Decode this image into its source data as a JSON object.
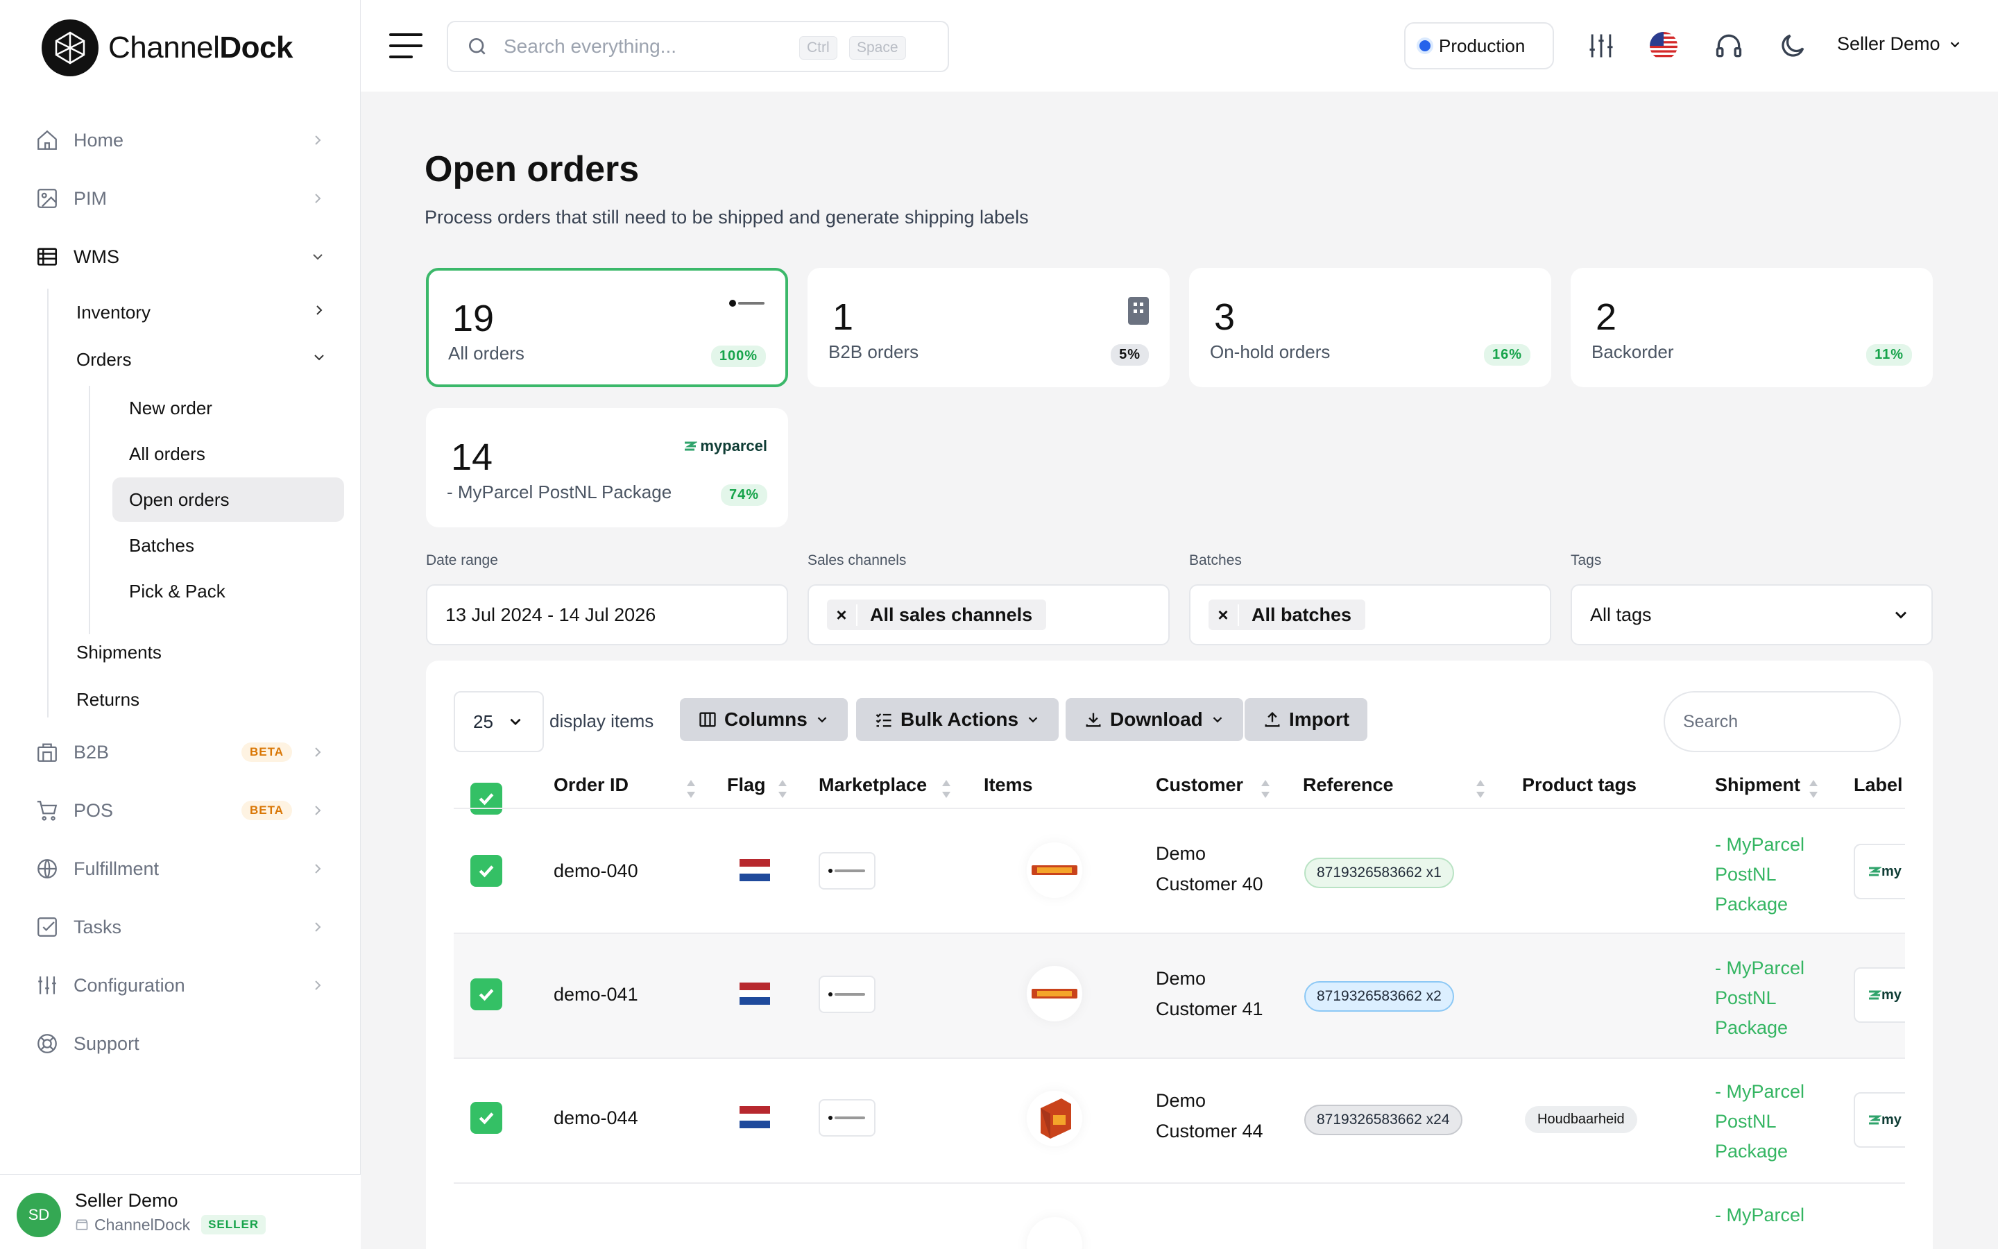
{
  "brand": {
    "name_light": "Channel",
    "name_bold": "Dock"
  },
  "sidebar": {
    "items": [
      {
        "label": "Home",
        "icon": "home-icon"
      },
      {
        "label": "PIM",
        "icon": "image-icon"
      },
      {
        "label": "WMS",
        "icon": "table-icon"
      },
      {
        "label": "B2B",
        "icon": "building-icon",
        "badge": "BETA"
      },
      {
        "label": "POS",
        "icon": "cart-icon",
        "badge": "BETA"
      },
      {
        "label": "Fulfillment",
        "icon": "globe-icon"
      },
      {
        "label": "Tasks",
        "icon": "checkbox-icon"
      },
      {
        "label": "Configuration",
        "icon": "sliders-icon"
      },
      {
        "label": "Support",
        "icon": "lifebuoy-icon"
      }
    ],
    "wms_sub": {
      "inventory": "Inventory",
      "orders": "Orders",
      "shipments": "Shipments",
      "returns": "Returns"
    },
    "orders_sub": [
      "New order",
      "All orders",
      "Open orders",
      "Batches",
      "Pick & Pack"
    ],
    "user": {
      "initials": "SD",
      "name": "Seller Demo",
      "org": "ChannelDock",
      "role": "SELLER"
    }
  },
  "topbar": {
    "search_placeholder": "Search everything...",
    "kbd1": "Ctrl",
    "kbd2": "Space",
    "environment": "Production",
    "user": "Seller Demo"
  },
  "page": {
    "title": "Open orders",
    "subtitle": "Process orders that still need to be shipped and generate shipping labels"
  },
  "stats": [
    {
      "count": "19",
      "label": "All orders",
      "pct": "100%"
    },
    {
      "count": "1",
      "label": "B2B orders",
      "pct": "5%"
    },
    {
      "count": "3",
      "label": "On-hold orders",
      "pct": "16%"
    },
    {
      "count": "2",
      "label": "Backorder",
      "pct": "11%"
    },
    {
      "count": "14",
      "label": "- MyParcel PostNL Package",
      "pct": "74%",
      "logo_text": "myparcel"
    }
  ],
  "filters": {
    "date_label": "Date range",
    "date_value": "13 Jul 2024 - 14 Jul 2026",
    "channels_label": "Sales channels",
    "channels_value": "All sales channels",
    "batches_label": "Batches",
    "batches_value": "All batches",
    "tags_label": "Tags",
    "tags_value": "All tags"
  },
  "toolbar": {
    "page_size": "25",
    "display_items": "display items",
    "columns": "Columns",
    "bulk": "Bulk Actions",
    "download": "Download",
    "import": "Import",
    "search_placeholder": "Search"
  },
  "table": {
    "headers": {
      "order_id": "Order ID",
      "flag": "Flag",
      "marketplace": "Marketplace",
      "items": "Items",
      "customer": "Customer",
      "reference": "Reference",
      "product_tags": "Product tags",
      "shipment": "Shipment",
      "label": "Label"
    },
    "rows": [
      {
        "order_id": "demo-040",
        "customer_1": "Demo",
        "customer_2": "Customer 40",
        "reference": "8719326583662 x1",
        "product_tag": "",
        "ship_1": "- MyParcel",
        "ship_2": "PostNL",
        "ship_3": "Package",
        "label": "my"
      },
      {
        "order_id": "demo-041",
        "customer_1": "Demo",
        "customer_2": "Customer 41",
        "reference": "8719326583662 x2",
        "product_tag": "",
        "ship_1": "- MyParcel",
        "ship_2": "PostNL",
        "ship_3": "Package",
        "label": "my"
      },
      {
        "order_id": "demo-044",
        "customer_1": "Demo",
        "customer_2": "Customer 44",
        "reference": "8719326583662 x24",
        "product_tag": "Houdbaarheid",
        "ship_1": "- MyParcel",
        "ship_2": "PostNL",
        "ship_3": "Package",
        "label": "my"
      },
      {
        "order_id": "",
        "customer_1": "",
        "customer_2": "",
        "reference": "",
        "product_tag": "",
        "ship_1": "- MyParcel",
        "ship_2": "",
        "ship_3": "",
        "label": ""
      }
    ]
  },
  "colors": {
    "accent_green": "#34c065",
    "selected_border": "#3bb86a",
    "env_dot": "#2563eb",
    "beta": "#d97706"
  }
}
